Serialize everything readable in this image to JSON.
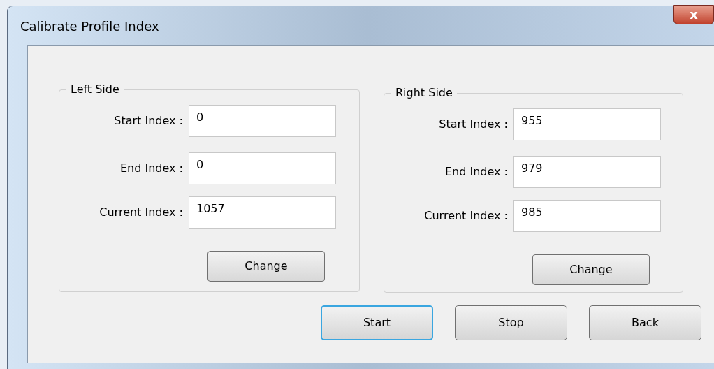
{
  "window": {
    "title": "Calibrate Profile Index",
    "close": "x"
  },
  "groups": [
    {
      "title": "Left Side",
      "fields": [
        {
          "label": "Start Index :",
          "value": "0"
        },
        {
          "label": "End Index :",
          "value": "0"
        },
        {
          "label": "Current Index :",
          "value": "1057"
        }
      ],
      "button": "Change"
    },
    {
      "title": "Right Side",
      "fields": [
        {
          "label": "Start Index :",
          "value": "955"
        },
        {
          "label": "End Index :",
          "value": "979"
        },
        {
          "label": "Current Index :",
          "value": "985"
        }
      ],
      "button": "Change"
    }
  ],
  "buttons": [
    {
      "label": "Start",
      "focused": true
    },
    {
      "label": "Stop",
      "focused": false
    },
    {
      "label": "Back",
      "focused": false
    }
  ]
}
